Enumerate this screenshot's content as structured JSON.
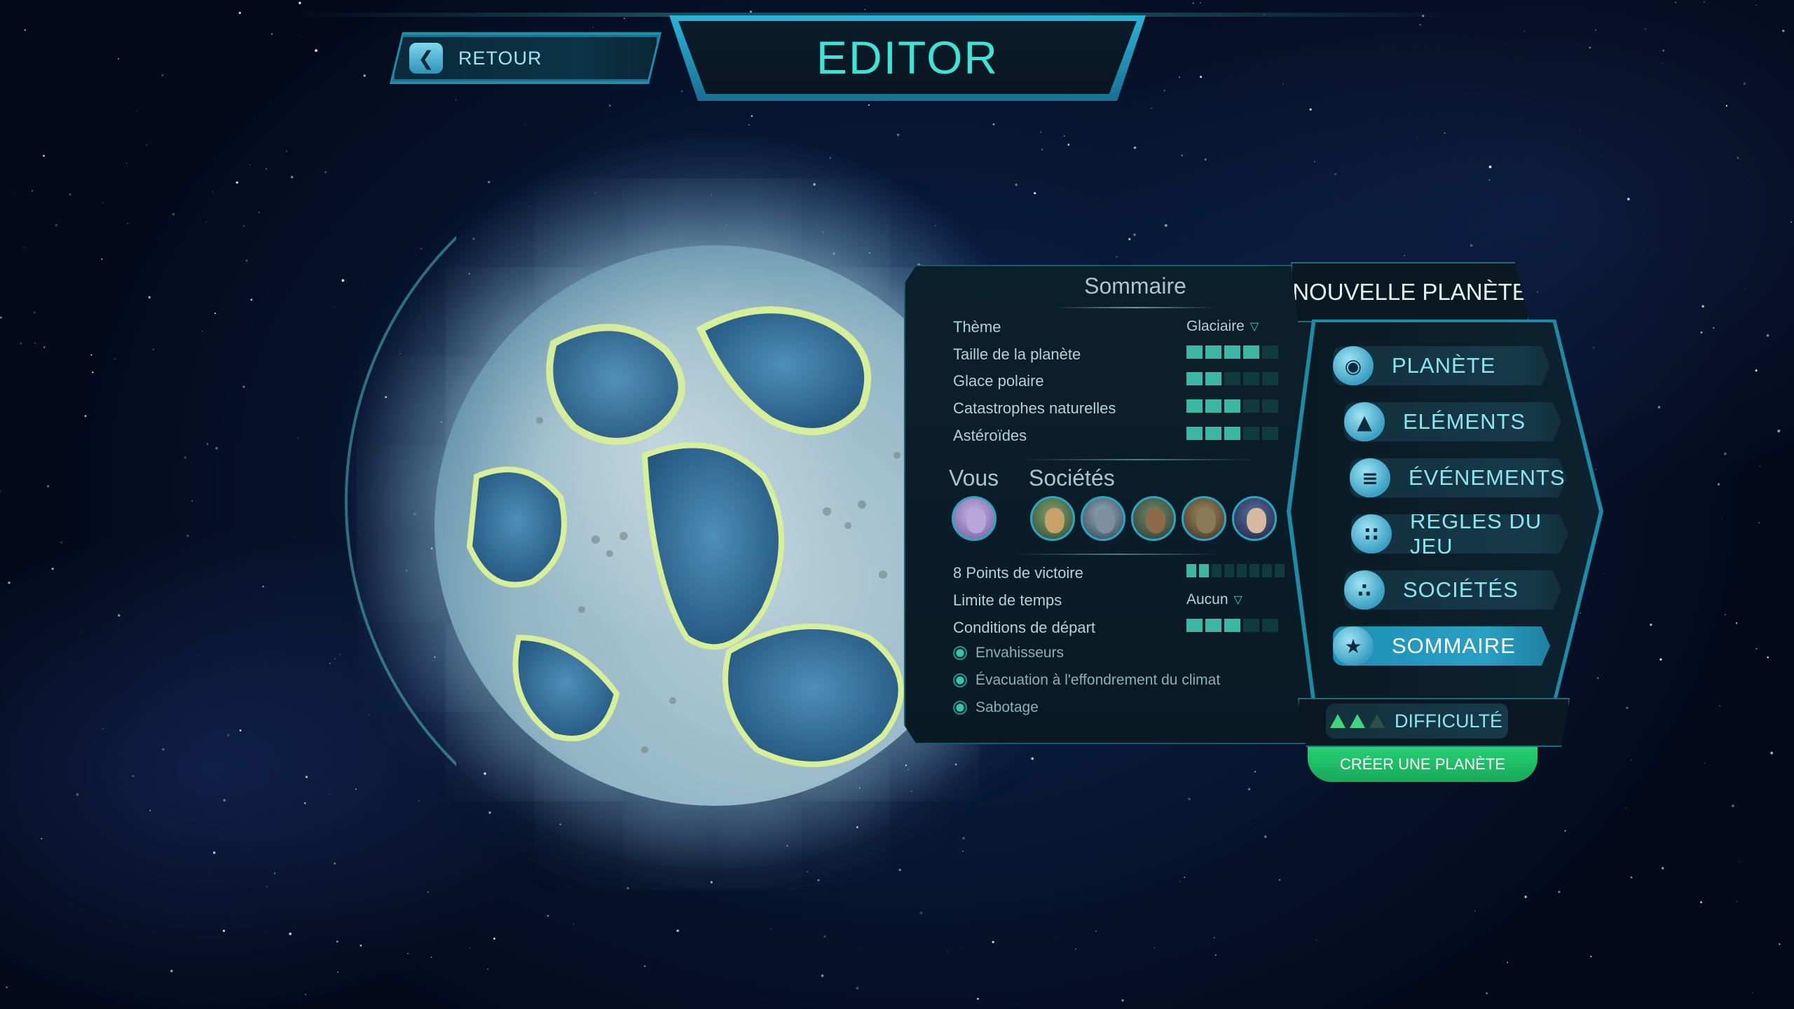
{
  "header": {
    "back_label": "RETOUR",
    "title": "EDITOR"
  },
  "summary": {
    "title": "Sommaire",
    "rows": [
      {
        "label": "Thème",
        "type": "dropdown",
        "value": "Glaciaire"
      },
      {
        "label": "Taille de la planète",
        "type": "level",
        "level": 4,
        "max": 5
      },
      {
        "label": "Glace polaire",
        "type": "level",
        "level": 2,
        "max": 5
      },
      {
        "label": "Catastrophes naturelles",
        "type": "level",
        "level": 3,
        "max": 5
      },
      {
        "label": "Astéroïdes",
        "type": "level",
        "level": 3,
        "max": 5
      }
    ],
    "you_label": "Vous",
    "societies_label": "Sociétés",
    "rules": [
      {
        "label": "8 Points de victoire",
        "type": "level",
        "level": 2,
        "max": 8
      },
      {
        "label": "Limite de temps",
        "type": "dropdown",
        "value": "Aucun"
      },
      {
        "label": "Conditions de départ",
        "type": "level",
        "level": 3,
        "max": 5
      }
    ],
    "options": [
      "Envahisseurs",
      "Évacuation à l'effondrement du climat",
      "Sabotage"
    ]
  },
  "menu": {
    "header": "NOUVELLE PLANÈTE",
    "items": [
      {
        "label": "PLANÈTE",
        "icon": "globe-icon"
      },
      {
        "label": "ELÉMENTS",
        "icon": "mountain-icon"
      },
      {
        "label": "ÉVÉNEMENTS",
        "icon": "tornado-icon"
      },
      {
        "label": "RÈGLES DU JEU",
        "icon": "dice-icon"
      },
      {
        "label": "SOCIÉTÉS",
        "icon": "circles-icon"
      },
      {
        "label": "SOMMAIRE",
        "icon": "star-icon",
        "active": true
      }
    ],
    "difficulty_label": "DIFFICULTÉ",
    "difficulty_level": 2,
    "difficulty_max": 3,
    "create_label": "CRÉER UNE PLANÈTE"
  },
  "colors": {
    "accent": "#3fe3d6",
    "active_item": "#2a9fc4",
    "create_button": "#26d073",
    "level_on": "#3bb7a4"
  }
}
